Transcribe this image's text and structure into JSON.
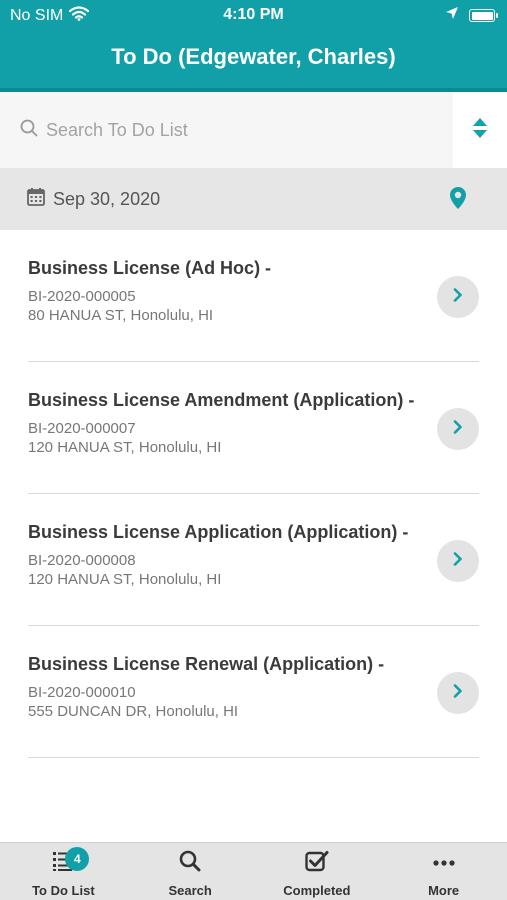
{
  "status_bar": {
    "carrier": "No SIM",
    "time": "4:10 PM"
  },
  "header": {
    "title": "To Do (Edgewater, Charles)"
  },
  "search": {
    "placeholder": "Search To Do List"
  },
  "date_filter": {
    "date": "Sep 30, 2020"
  },
  "items": [
    {
      "title": "Business License (Ad Hoc) -",
      "record_id": "BI-2020-000005",
      "address": "80 HANUA ST, Honolulu, HI"
    },
    {
      "title": "Business License Amendment (Application) -",
      "record_id": "BI-2020-000007",
      "address": "120 HANUA ST, Honolulu, HI"
    },
    {
      "title": "Business License Application (Application) -",
      "record_id": "BI-2020-000008",
      "address": "120 HANUA ST, Honolulu, HI"
    },
    {
      "title": "Business License Renewal (Application) -",
      "record_id": "BI-2020-000010",
      "address": "555 DUNCAN DR, Honolulu, HI"
    }
  ],
  "tabbar": {
    "tabs": [
      {
        "label": "To Do List",
        "icon": "todo-list-icon",
        "badge": "4"
      },
      {
        "label": "Search",
        "icon": "search-icon"
      },
      {
        "label": "Completed",
        "icon": "checkbox-icon"
      },
      {
        "label": "More",
        "icon": "more-icon"
      }
    ]
  },
  "colors": {
    "accent": "#11a0a8",
    "header_border": "#0b8a92",
    "tabbar_bg": "#e4e4e4"
  }
}
